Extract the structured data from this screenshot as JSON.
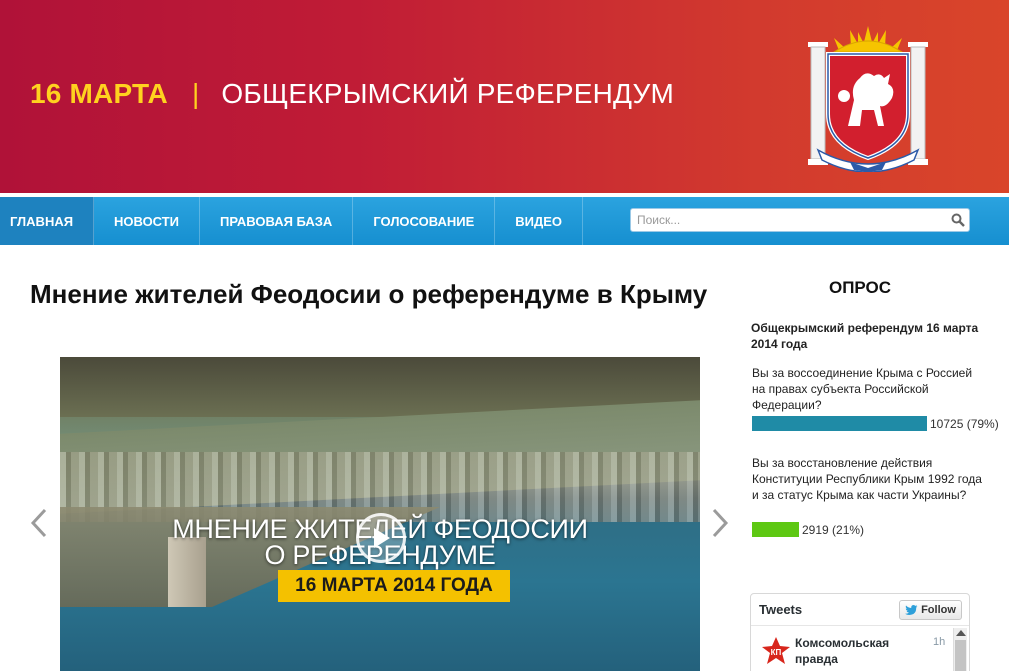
{
  "header": {
    "date": "16 МАРТА",
    "separator": "|",
    "title": "ОБЩЕКРЫМСКИЙ РЕФЕРЕНДУМ",
    "emblem_icon": "crimea-coat-of-arms-icon",
    "colors": {
      "banner_start": "#b01238",
      "banner_end": "#d9452a",
      "date": "#ffd21f"
    }
  },
  "nav": {
    "items": [
      {
        "label": "ГЛАВНАЯ",
        "active": true
      },
      {
        "label": "НОВОСТИ",
        "active": false
      },
      {
        "label": "ПРАВОВАЯ БАЗА",
        "active": false
      },
      {
        "label": "ГОЛОСОВАНИЕ",
        "active": false
      },
      {
        "label": "ВИДЕО",
        "active": false
      }
    ],
    "search": {
      "placeholder": "Поиск...",
      "value": "",
      "icon": "search-icon"
    },
    "colors": {
      "bar": "#1c95d4",
      "active": "#1e82bf"
    }
  },
  "article": {
    "title": "Мнение жителей Феодосии о референдуме в Крыму",
    "video": {
      "caption_line1": "МНЕНИЕ ЖИТЕЛЕЙ ФЕОДОСИИ",
      "caption_line2": "О РЕФЕРЕНДУМЕ",
      "date_banner": "16 МАРТА 2014 ГОДА",
      "play_icon": "play-icon"
    },
    "prev_icon": "chevron-left-icon",
    "next_icon": "chevron-right-icon"
  },
  "poll": {
    "heading": "ОПРОС",
    "title": "Общекрымский референдум 16 марта 2014 года",
    "options": [
      {
        "question": "Вы за воссоединение Крыма с Россией на правах субъекта Российской Федерации?",
        "result": "10725 (79%)",
        "percent": 79,
        "color": "#1f8ba6"
      },
      {
        "question": "Вы за восстановление действия Конституции Республики Крым 1992 года и за статус Крыма как части Украины?",
        "result": "2919 (21%)",
        "percent": 21,
        "color": "#5ec813"
      }
    ]
  },
  "tweets": {
    "title": "Tweets",
    "follow_label": "Follow",
    "follow_icon": "twitter-bird-icon",
    "items": [
      {
        "author": "Комсомольская правда",
        "time": "1h",
        "avatar_icon": "kp-logo-icon"
      }
    ]
  }
}
